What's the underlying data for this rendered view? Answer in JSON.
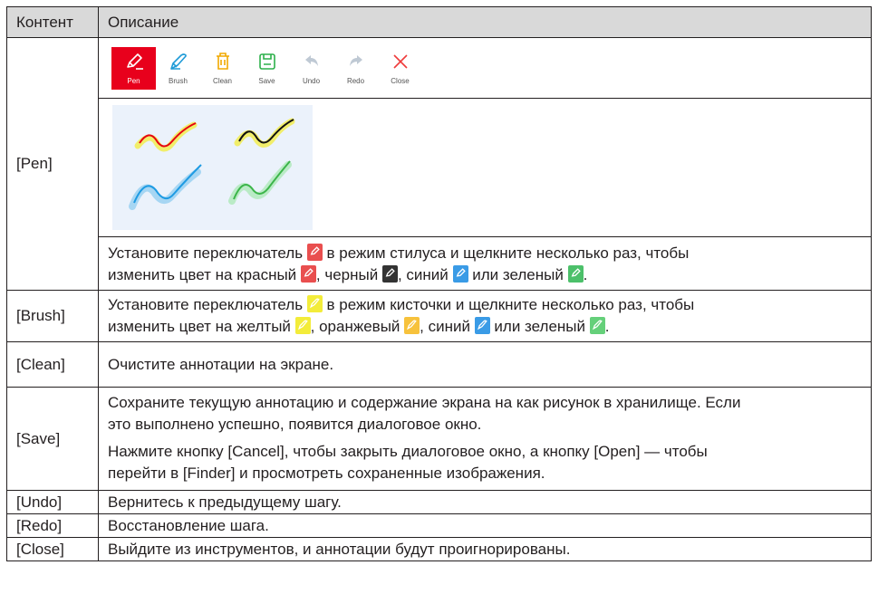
{
  "headers": {
    "content": "Контент",
    "description": "Описание"
  },
  "toolbar": [
    {
      "label": "Pen",
      "icon": "pen-icon",
      "color": "#e8001c"
    },
    {
      "label": "Brush",
      "icon": "brush-icon",
      "color": "#1f9bd7"
    },
    {
      "label": "Clean",
      "icon": "trash-icon",
      "color": "#f2a900"
    },
    {
      "label": "Save",
      "icon": "save-icon",
      "color": "#2db04b"
    },
    {
      "label": "Undo",
      "icon": "undo-icon",
      "color": "#bfc9d4"
    },
    {
      "label": "Redo",
      "icon": "redo-icon",
      "color": "#bfc9d4"
    },
    {
      "label": "Close",
      "icon": "close-icon",
      "color": "#ef3b3b"
    }
  ],
  "pen_colors": {
    "red": "#e94f4f",
    "black": "#333333",
    "blue": "#3a9be6",
    "green": "#4cc06a"
  },
  "brush_colors": {
    "yellow": "#f3ec3a",
    "orange": "#f7c23c",
    "blue": "#3a9be6",
    "green": "#65d07a"
  },
  "rows": {
    "pen": {
      "name": "[Pen]",
      "t1": "Установите переключатель ",
      "t2": " в режим стилуса и щелкните несколько раз, чтобы",
      "t3": "изменить цвет на красный ",
      "t4": ", черный ",
      "t5": ", синий ",
      "t6": " или зеленый ",
      "t7": "."
    },
    "brush": {
      "name": "[Brush]",
      "t1": "Установите переключатель ",
      "t2": " в режим кисточки и щелкните несколько раз, чтобы",
      "t3": "изменить цвет на желтый ",
      "t4": ", оранжевый ",
      "t5": ", синий ",
      "t6": " или зеленый ",
      "t7": "."
    },
    "clean": {
      "name": "[Clean]",
      "desc": "Очистите аннотации на экране."
    },
    "save": {
      "name": "[Save]",
      "p1a": "Сохраните текущую аннотацию и содержание экрана на как рисунок в хранилище. Если",
      "p1b": "это выполнено успешно, появится диалоговое окно.",
      "p2a": "Нажмите кнопку [Cancel], чтобы закрыть диалоговое окно, а кнопку [Open] — чтобы",
      "p2b": "перейти в [Finder] и просмотреть сохраненные изображения."
    },
    "undo": {
      "name": "[Undo]",
      "desc": "Вернитесь к предыдущему шагу."
    },
    "redo": {
      "name": "[Redo]",
      "desc": "Восстановление шага."
    },
    "close": {
      "name": "[Close]",
      "desc": "Выйдите из инструментов, и аннотации будут проигнорированы."
    }
  }
}
